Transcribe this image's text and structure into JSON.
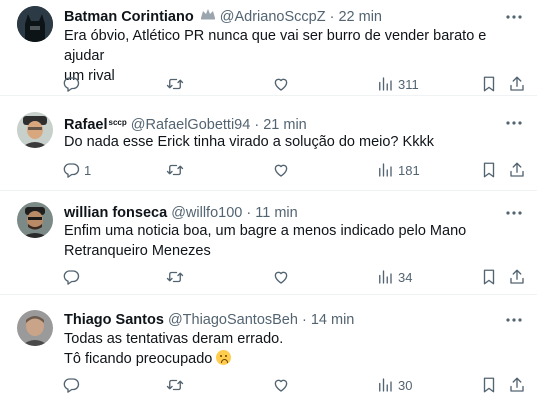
{
  "tweets": [
    {
      "name": "Batman Corintiano",
      "badge": "",
      "handle": "@AdrianoSccpZ",
      "time": "22 min",
      "lines": [
        "Era óbvio, Atlético PR nunca que vai ser burro de vender barato e ajudar",
        "um rival"
      ],
      "replies": "",
      "views": "311",
      "avatar_icon": "batman-avatar"
    },
    {
      "name": "Rafael",
      "badge": "sccp",
      "handle": "@RafaelGobetti94",
      "time": "21 min",
      "lines": [
        "Do nada esse Erick tinha virado a solução do meio? Kkkk"
      ],
      "replies": "1",
      "views": "181",
      "avatar_icon": "person-avatar"
    },
    {
      "name": "willian fonseca",
      "badge": "",
      "handle": "@willfo100",
      "time": "11 min",
      "lines": [
        "Enfim uma noticia boa, um bagre a menos indicado pelo Mano",
        "Retranqueiro Menezes"
      ],
      "replies": "",
      "views": "34",
      "avatar_icon": "person-avatar"
    },
    {
      "name": "Thiago Santos",
      "badge": "",
      "handle": "@ThiagoSantosBeh",
      "time": "14 min",
      "lines": [
        "Todas as tentativas deram errado.",
        "Tô ficando preocupado"
      ],
      "replies": "",
      "views": "30",
      "avatar_icon": "person-avatar"
    }
  ],
  "separator": "·",
  "colors": {
    "text": "#0f1419",
    "muted": "#536471",
    "border": "#eff3f4"
  }
}
